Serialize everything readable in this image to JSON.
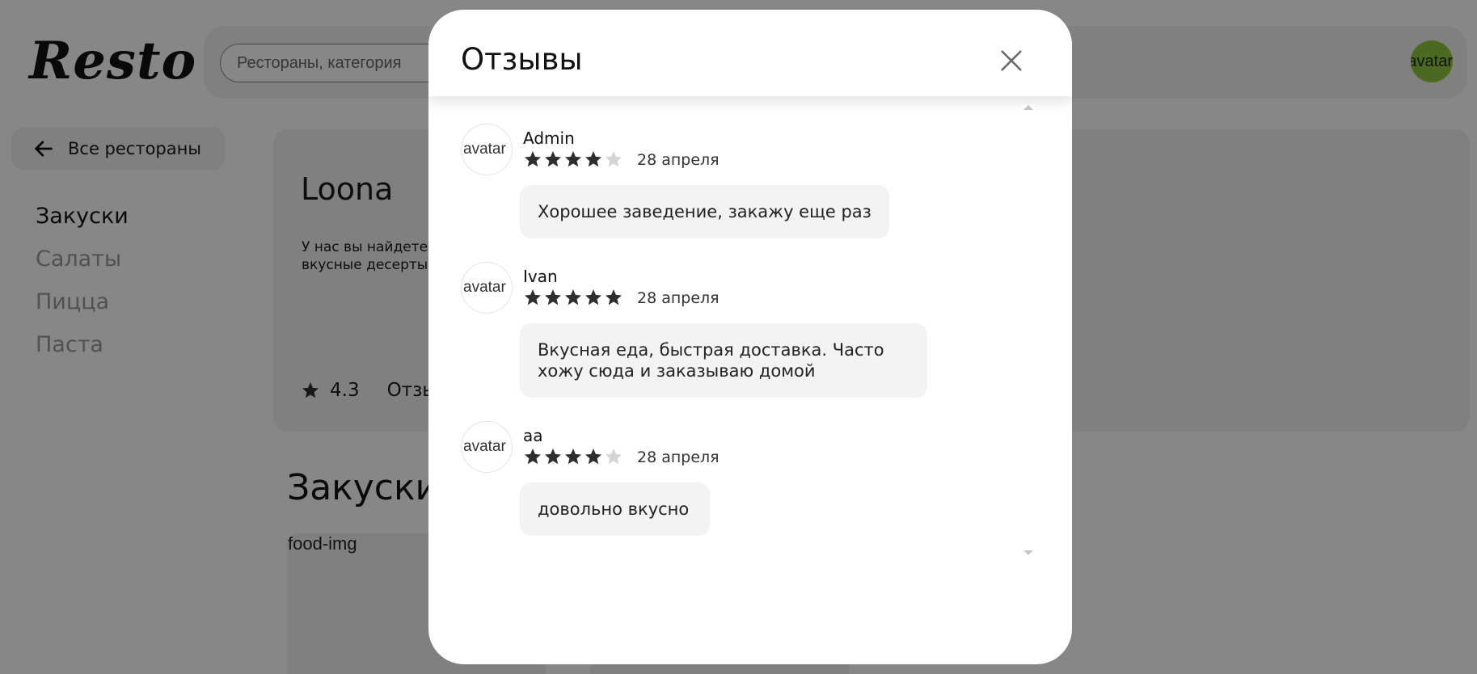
{
  "logo": "Resto",
  "search": {
    "placeholder": "Рестораны, категория"
  },
  "user_avatar_alt": "avatar",
  "back_button": {
    "label": "Все рестораны",
    "icon": "arrow-left-icon"
  },
  "categories": [
    {
      "label": "Закуски",
      "active": true
    },
    {
      "label": "Салаты",
      "active": false
    },
    {
      "label": "Пицца",
      "active": false
    },
    {
      "label": "Паста",
      "active": false
    }
  ],
  "restaurant": {
    "name": "Loona",
    "description_lines": [
      "У нас вы найдете",
      "вкусные десерты"
    ],
    "rating": "4.3",
    "reviews_link": "Отзывы"
  },
  "section_title": "Закуски",
  "food_img_alt": "food-img",
  "modal": {
    "title": "Отзывы",
    "close_icon": "close-icon",
    "reviews": [
      {
        "avatar_alt": "avatar",
        "name": "Admin",
        "rating": 4,
        "date": "28 апреля",
        "text": "Хорошее заведение, закажу еще раз"
      },
      {
        "avatar_alt": "avatar",
        "name": "Ivan",
        "rating": 5,
        "date": "28 апреля",
        "text": "Вкусная еда, быстрая доставка. Часто хожу сюда и заказываю домой"
      },
      {
        "avatar_alt": "avatar",
        "name": "aa",
        "rating": 4,
        "date": "28 апреля",
        "text": "довольно вкусно"
      }
    ]
  },
  "colors": {
    "star_filled": "#2e2e2e",
    "star_empty": "#d4d4d4",
    "overlay": "rgba(0,0,0,0.47)",
    "avatar_green": "#8ec63f"
  }
}
